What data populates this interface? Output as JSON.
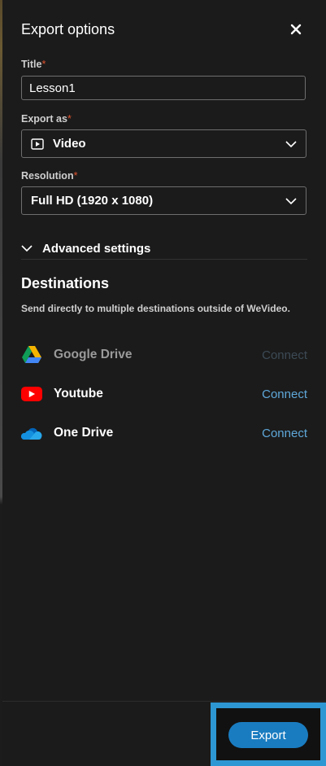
{
  "header": {
    "title": "Export options",
    "close_icon": "close-icon"
  },
  "fields": {
    "title": {
      "label": "Title",
      "required_mark": "*",
      "value": "Lesson1"
    },
    "export_as": {
      "label": "Export as",
      "required_mark": "*",
      "value": "Video",
      "icon": "play-icon"
    },
    "resolution": {
      "label": "Resolution",
      "required_mark": "*",
      "value": "Full HD (1920 x 1080)"
    }
  },
  "advanced": {
    "label": "Advanced settings"
  },
  "destinations": {
    "title": "Destinations",
    "description": "Send directly to multiple destinations outside of WeVideo.",
    "items": [
      {
        "name": "Google Drive",
        "action": "Connect",
        "icon": "google-drive-icon",
        "enabled": false
      },
      {
        "name": "Youtube",
        "action": "Connect",
        "icon": "youtube-icon",
        "enabled": true
      },
      {
        "name": "One Drive",
        "action": "Connect",
        "icon": "onedrive-icon",
        "enabled": true
      }
    ]
  },
  "footer": {
    "export_label": "Export"
  },
  "colors": {
    "background": "#1b1b1b",
    "required": "#e0532e",
    "link": "#5fa8d9",
    "primary_button": "#1a7cc0",
    "highlight": "#2d97d3"
  }
}
